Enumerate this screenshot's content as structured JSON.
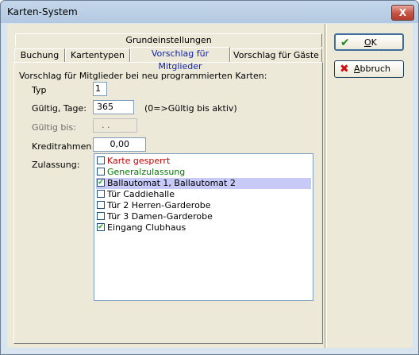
{
  "window": {
    "title": "Karten-System",
    "close_symbol": "X"
  },
  "tabs": {
    "top_row": [
      {
        "label": "Grundeinstellungen"
      }
    ],
    "bottom_row": [
      {
        "label": "Buchung"
      },
      {
        "label": "Kartentypen"
      },
      {
        "label": "Vorschlag für Mitglieder",
        "active": true
      },
      {
        "label": "Vorschlag für Gäste"
      }
    ]
  },
  "form": {
    "heading": "Vorschlag für Mitglieder bei neu programmierten Karten:",
    "typ_label": "Typ",
    "typ_value": "1",
    "gueltig_tage_label": "Gültig, Tage:",
    "gueltig_tage_value": "365",
    "gueltig_tage_hint": "(0=>Gültig bis aktiv)",
    "gueltig_bis_label": "Gültig bis:",
    "gueltig_bis_value": ". .",
    "kreditrahmen_label": "Kreditrahmen",
    "kreditrahmen_value": "0,00",
    "zulassung_label": "Zulassung:"
  },
  "zulassung": [
    {
      "label": "Karte gesperrt",
      "checked": false,
      "color": "#c00000"
    },
    {
      "label": "Generalzulassung",
      "checked": false,
      "color": "#007a00"
    },
    {
      "label": "Ballautomat 1, Ballautomat 2",
      "checked": true,
      "color": "#000000",
      "selected": true
    },
    {
      "label": "Tür Caddiehalle",
      "checked": false,
      "color": "#000000"
    },
    {
      "label": "Tür 2 Herren-Garderobe",
      "checked": false,
      "color": "#000000"
    },
    {
      "label": "Tür 3 Damen-Garderobe",
      "checked": false,
      "color": "#000000"
    },
    {
      "label": "Eingang Clubhaus",
      "checked": true,
      "color": "#000000"
    }
  ],
  "buttons": {
    "ok": {
      "label": "OK",
      "icon": "check-icon",
      "icon_color": "#1e8a1e"
    },
    "abbruch": {
      "label": "Abbruch",
      "icon": "cross-icon",
      "icon_color": "#d01010"
    }
  }
}
